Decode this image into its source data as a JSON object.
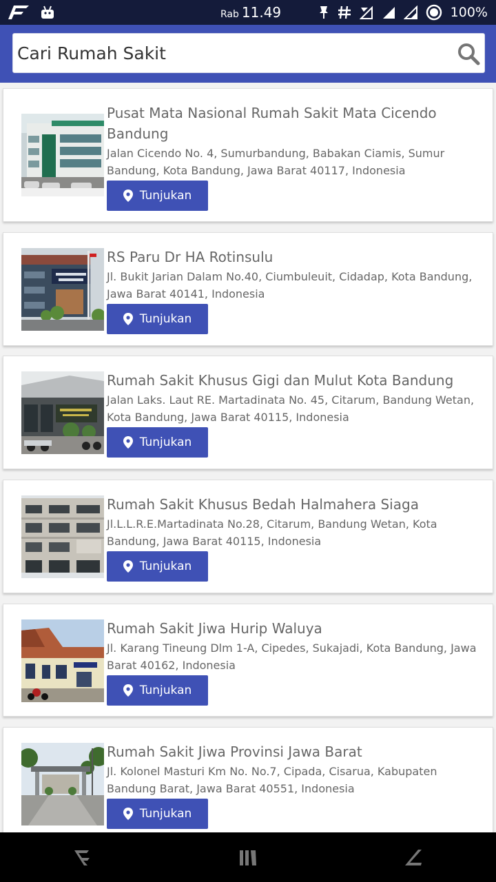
{
  "status_bar": {
    "day": "Rab",
    "time": "11.49",
    "battery": "100%"
  },
  "search": {
    "placeholder": "Cari Rumah Sakit"
  },
  "hospitals": [
    {
      "name": "Pusat Mata Nasional Rumah Sakit Mata Cicendo Bandung",
      "address": "Jalan Cicendo No. 4, Sumurbandung, Babakan Ciamis, Sumur Bandung, Kota Bandung, Jawa  Barat 40117, Indonesia",
      "button": "Tunjukan"
    },
    {
      "name": "RS Paru Dr HA Rotinsulu",
      "address": "Jl. Bukit Jarian Dalam No.40, Ciumbuleuit, Cidadap, Kota Bandung, Jawa Barat 40141,  Indonesia",
      "button": "Tunjukan"
    },
    {
      "name": "Rumah Sakit Khusus Gigi dan Mulut Kota Bandung",
      "address": "Jalan Laks. Laut RE. Martadinata No. 45, Citarum, Bandung Wetan, Kota Bandung, Jawa  Barat 40115, Indonesia",
      "button": "Tunjukan"
    },
    {
      "name": "Rumah Sakit Khusus Bedah Halmahera Siaga",
      "address": "Jl.L.L.R.E.Martadinata No.28, Citarum, Bandung Wetan, Kota Bandung, Jawa Barat 40115, Indonesia",
      "button": "Tunjukan"
    },
    {
      "name": "Rumah Sakit Jiwa Hurip Waluya",
      "address": "Jl. Karang Tineung Dlm 1-A, Cipedes, Sukajadi, Kota Bandung, Jawa Barat 40162, Indonesia",
      "button": "Tunjukan"
    },
    {
      "name": "Rumah Sakit Jiwa Provinsi Jawa Barat",
      "address": "Jl. Kolonel Masturi Km No. No.7, Cipada, Cisarua, Kabupaten Bandung Barat, Jawa Barat 40551, Indonesia",
      "button": "Tunjukan"
    }
  ],
  "icons": {
    "search": "search-icon",
    "marker": "map-marker-icon",
    "nav_back": "back-icon",
    "nav_home": "home-icon",
    "nav_recent": "recent-apps-icon"
  },
  "colors": {
    "primary": "#3f51b5",
    "status_bar": "#141b3a",
    "nav_bar": "#000000",
    "card": "#ffffff"
  }
}
